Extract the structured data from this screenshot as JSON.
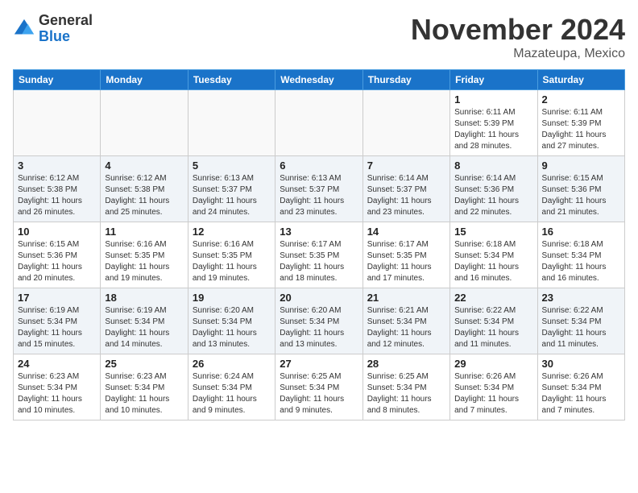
{
  "header": {
    "logo": {
      "general": "General",
      "blue": "Blue"
    },
    "title": "November 2024",
    "subtitle": "Mazateupa, Mexico"
  },
  "weekdays": [
    "Sunday",
    "Monday",
    "Tuesday",
    "Wednesday",
    "Thursday",
    "Friday",
    "Saturday"
  ],
  "weeks": [
    [
      {
        "day": "",
        "info": ""
      },
      {
        "day": "",
        "info": ""
      },
      {
        "day": "",
        "info": ""
      },
      {
        "day": "",
        "info": ""
      },
      {
        "day": "",
        "info": ""
      },
      {
        "day": "1",
        "info": "Sunrise: 6:11 AM\nSunset: 5:39 PM\nDaylight: 11 hours\nand 28 minutes."
      },
      {
        "day": "2",
        "info": "Sunrise: 6:11 AM\nSunset: 5:39 PM\nDaylight: 11 hours\nand 27 minutes."
      }
    ],
    [
      {
        "day": "3",
        "info": "Sunrise: 6:12 AM\nSunset: 5:38 PM\nDaylight: 11 hours\nand 26 minutes."
      },
      {
        "day": "4",
        "info": "Sunrise: 6:12 AM\nSunset: 5:38 PM\nDaylight: 11 hours\nand 25 minutes."
      },
      {
        "day": "5",
        "info": "Sunrise: 6:13 AM\nSunset: 5:37 PM\nDaylight: 11 hours\nand 24 minutes."
      },
      {
        "day": "6",
        "info": "Sunrise: 6:13 AM\nSunset: 5:37 PM\nDaylight: 11 hours\nand 23 minutes."
      },
      {
        "day": "7",
        "info": "Sunrise: 6:14 AM\nSunset: 5:37 PM\nDaylight: 11 hours\nand 23 minutes."
      },
      {
        "day": "8",
        "info": "Sunrise: 6:14 AM\nSunset: 5:36 PM\nDaylight: 11 hours\nand 22 minutes."
      },
      {
        "day": "9",
        "info": "Sunrise: 6:15 AM\nSunset: 5:36 PM\nDaylight: 11 hours\nand 21 minutes."
      }
    ],
    [
      {
        "day": "10",
        "info": "Sunrise: 6:15 AM\nSunset: 5:36 PM\nDaylight: 11 hours\nand 20 minutes."
      },
      {
        "day": "11",
        "info": "Sunrise: 6:16 AM\nSunset: 5:35 PM\nDaylight: 11 hours\nand 19 minutes."
      },
      {
        "day": "12",
        "info": "Sunrise: 6:16 AM\nSunset: 5:35 PM\nDaylight: 11 hours\nand 19 minutes."
      },
      {
        "day": "13",
        "info": "Sunrise: 6:17 AM\nSunset: 5:35 PM\nDaylight: 11 hours\nand 18 minutes."
      },
      {
        "day": "14",
        "info": "Sunrise: 6:17 AM\nSunset: 5:35 PM\nDaylight: 11 hours\nand 17 minutes."
      },
      {
        "day": "15",
        "info": "Sunrise: 6:18 AM\nSunset: 5:34 PM\nDaylight: 11 hours\nand 16 minutes."
      },
      {
        "day": "16",
        "info": "Sunrise: 6:18 AM\nSunset: 5:34 PM\nDaylight: 11 hours\nand 16 minutes."
      }
    ],
    [
      {
        "day": "17",
        "info": "Sunrise: 6:19 AM\nSunset: 5:34 PM\nDaylight: 11 hours\nand 15 minutes."
      },
      {
        "day": "18",
        "info": "Sunrise: 6:19 AM\nSunset: 5:34 PM\nDaylight: 11 hours\nand 14 minutes."
      },
      {
        "day": "19",
        "info": "Sunrise: 6:20 AM\nSunset: 5:34 PM\nDaylight: 11 hours\nand 13 minutes."
      },
      {
        "day": "20",
        "info": "Sunrise: 6:20 AM\nSunset: 5:34 PM\nDaylight: 11 hours\nand 13 minutes."
      },
      {
        "day": "21",
        "info": "Sunrise: 6:21 AM\nSunset: 5:34 PM\nDaylight: 11 hours\nand 12 minutes."
      },
      {
        "day": "22",
        "info": "Sunrise: 6:22 AM\nSunset: 5:34 PM\nDaylight: 11 hours\nand 11 minutes."
      },
      {
        "day": "23",
        "info": "Sunrise: 6:22 AM\nSunset: 5:34 PM\nDaylight: 11 hours\nand 11 minutes."
      }
    ],
    [
      {
        "day": "24",
        "info": "Sunrise: 6:23 AM\nSunset: 5:34 PM\nDaylight: 11 hours\nand 10 minutes."
      },
      {
        "day": "25",
        "info": "Sunrise: 6:23 AM\nSunset: 5:34 PM\nDaylight: 11 hours\nand 10 minutes."
      },
      {
        "day": "26",
        "info": "Sunrise: 6:24 AM\nSunset: 5:34 PM\nDaylight: 11 hours\nand 9 minutes."
      },
      {
        "day": "27",
        "info": "Sunrise: 6:25 AM\nSunset: 5:34 PM\nDaylight: 11 hours\nand 9 minutes."
      },
      {
        "day": "28",
        "info": "Sunrise: 6:25 AM\nSunset: 5:34 PM\nDaylight: 11 hours\nand 8 minutes."
      },
      {
        "day": "29",
        "info": "Sunrise: 6:26 AM\nSunset: 5:34 PM\nDaylight: 11 hours\nand 7 minutes."
      },
      {
        "day": "30",
        "info": "Sunrise: 6:26 AM\nSunset: 5:34 PM\nDaylight: 11 hours\nand 7 minutes."
      }
    ]
  ]
}
